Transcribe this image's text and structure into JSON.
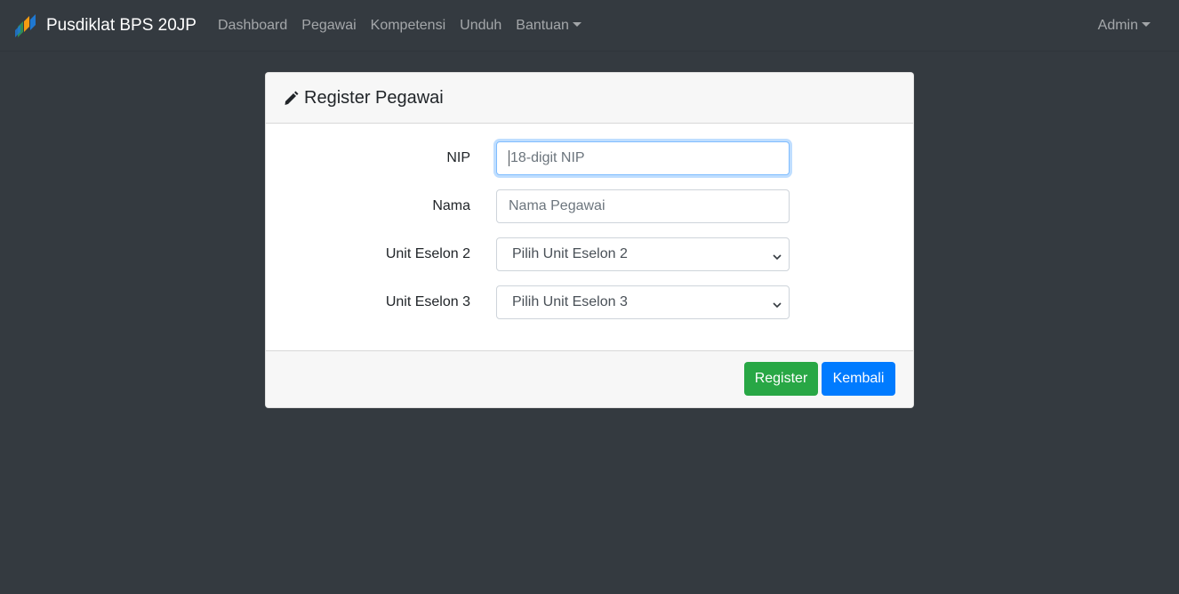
{
  "navbar": {
    "brand": "Pusdiklat BPS 20JP",
    "links": [
      {
        "label": "Dashboard"
      },
      {
        "label": "Pegawai"
      },
      {
        "label": "Kompetensi"
      },
      {
        "label": "Unduh"
      },
      {
        "label": "Bantuan",
        "dropdown": true
      }
    ],
    "user": {
      "label": "Admin",
      "dropdown": true
    }
  },
  "card": {
    "title": "Register Pegawai",
    "icon": "pencil-icon",
    "fields": {
      "nip": {
        "label": "NIP",
        "value": "",
        "placeholder": "18-digit NIP"
      },
      "nama": {
        "label": "Nama",
        "value": "",
        "placeholder": "Nama Pegawai"
      },
      "eselon2": {
        "label": "Unit Eselon 2",
        "selected": "Pilih Unit Eselon 2"
      },
      "eselon3": {
        "label": "Unit Eselon 3",
        "selected": "Pilih Unit Eselon 3"
      }
    },
    "buttons": {
      "register": "Register",
      "kembali": "Kembali"
    }
  },
  "colors": {
    "background": "#343a40",
    "register": "#28a745",
    "kembali": "#007bff",
    "focus": "#80bdff"
  }
}
